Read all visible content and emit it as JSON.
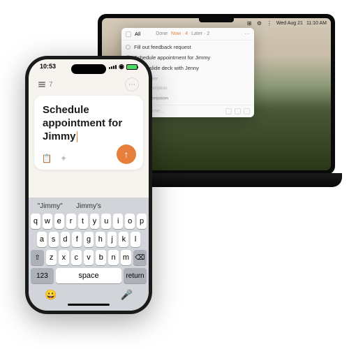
{
  "laptop": {
    "menubar": {
      "date": "Wed Aug 21",
      "time": "11:10 AM"
    },
    "app": {
      "toolbar": {
        "all": "All",
        "tabs": [
          {
            "label": "Done",
            "active": false
          },
          {
            "label": "Now · 4",
            "active": true
          },
          {
            "label": "Later · 2",
            "active": false
          }
        ]
      },
      "tasks": [
        {
          "text": "Fill out feedback request"
        },
        {
          "text": "Schedule appointment for Jimmy"
        },
        {
          "text": "Share slide deck with Jenny"
        },
        {
          "text": "if this later"
        },
        {
          "text": "on prescription"
        }
      ],
      "input_placeholder": "e.g. buy time..."
    }
  },
  "phone": {
    "status": {
      "time": "10:53"
    },
    "header": {
      "count": "7"
    },
    "compose": {
      "text": "Schedule appointment for Jimmy"
    },
    "keyboard": {
      "suggestions": [
        "\"Jimmy\"",
        "Jimmy's",
        ""
      ],
      "row1": [
        "q",
        "w",
        "e",
        "r",
        "t",
        "y",
        "u",
        "i",
        "o",
        "p"
      ],
      "row2": [
        "a",
        "s",
        "d",
        "f",
        "g",
        "h",
        "j",
        "k",
        "l"
      ],
      "row3": [
        "⇧",
        "z",
        "x",
        "c",
        "v",
        "b",
        "n",
        "m",
        "⌫"
      ],
      "row4": {
        "num": "123",
        "space": "space",
        "return": "return"
      }
    }
  },
  "colors": {
    "accent": "#e67e3c"
  }
}
